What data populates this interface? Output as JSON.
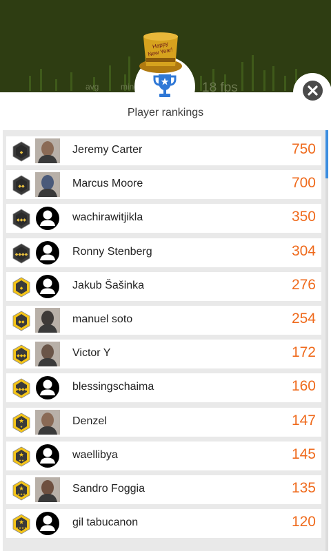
{
  "fps": {
    "avg_label": "avg",
    "min_label": "min",
    "value_text": "18 fps"
  },
  "header": {
    "title": "Player rankings"
  },
  "hat_text": "Happy New Year!",
  "colors": {
    "score": "#ef6a1c",
    "scroll": "#3b8de0",
    "rank_dark": "#3a3a3a",
    "rank_gold": "#f5c518"
  },
  "players": [
    {
      "name": "Jeremy Carter",
      "score": "750",
      "rank_icon": "rank-dark-1-icon",
      "avatar": "photo"
    },
    {
      "name": "Marcus Moore",
      "score": "700",
      "rank_icon": "rank-dark-2-icon",
      "avatar": "photo"
    },
    {
      "name": "wachirawitjikla",
      "score": "350",
      "rank_icon": "rank-dark-3-icon",
      "avatar": "default"
    },
    {
      "name": "Ronny Stenberg",
      "score": "304",
      "rank_icon": "rank-dark-4-icon",
      "avatar": "default"
    },
    {
      "name": "Jakub Šašinka",
      "score": "276",
      "rank_icon": "rank-gold-1-icon",
      "avatar": "default"
    },
    {
      "name": "manuel soto",
      "score": "254",
      "rank_icon": "rank-gold-2-icon",
      "avatar": "photo"
    },
    {
      "name": "Victor Y",
      "score": "172",
      "rank_icon": "rank-gold-3-icon",
      "avatar": "photo"
    },
    {
      "name": "blessingschaima",
      "score": "160",
      "rank_icon": "rank-gold-4-icon",
      "avatar": "default"
    },
    {
      "name": "Denzel",
      "score": "147",
      "rank_icon": "rank-star-1-icon",
      "avatar": "photo"
    },
    {
      "name": "waellibya",
      "score": "145",
      "rank_icon": "rank-star-2-icon",
      "avatar": "default"
    },
    {
      "name": "Sandro Foggia",
      "score": "135",
      "rank_icon": "rank-star-3-icon",
      "avatar": "photo"
    },
    {
      "name": "gil tabucanon",
      "score": "120",
      "rank_icon": "rank-star-4-icon",
      "avatar": "default"
    }
  ]
}
